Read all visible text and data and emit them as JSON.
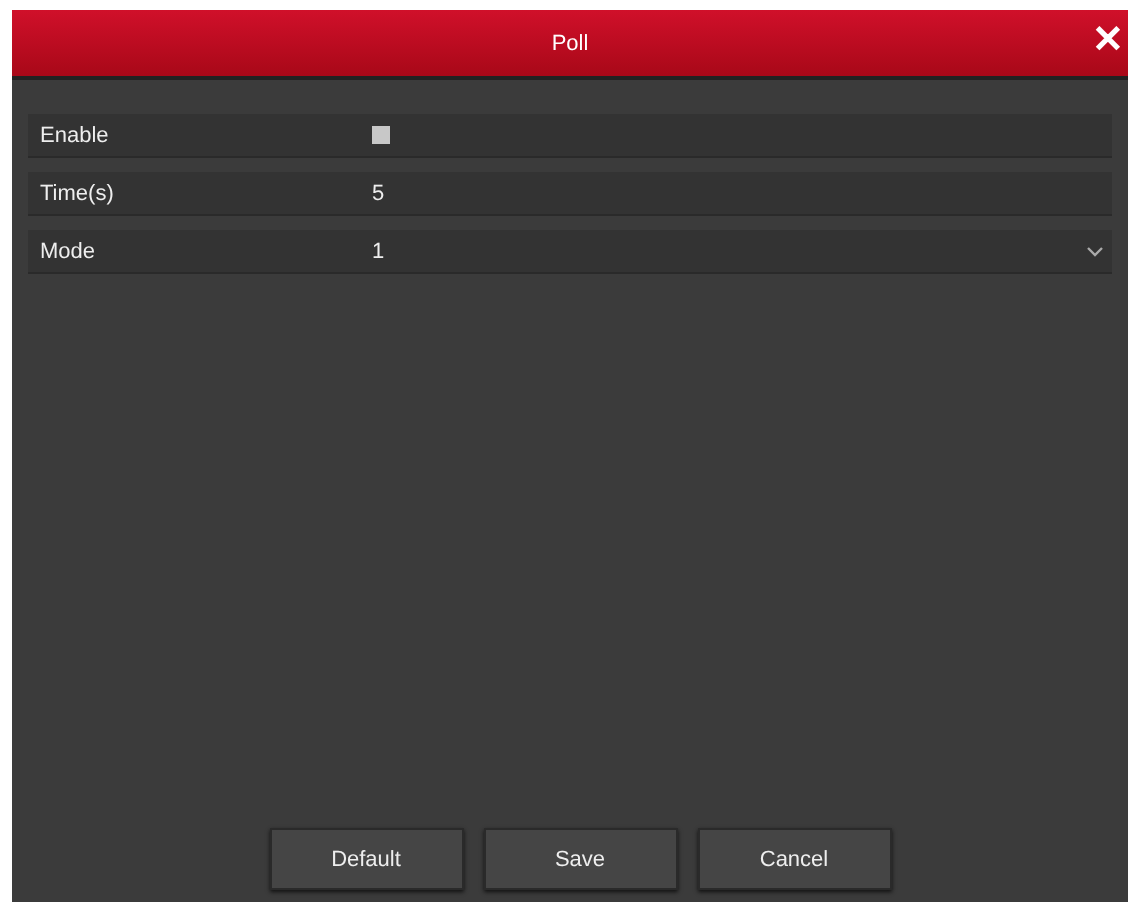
{
  "window": {
    "title": "Poll",
    "close": "✕"
  },
  "fields": [
    {
      "kind": "checkbox",
      "label": "Enable",
      "checked": false
    },
    {
      "kind": "text",
      "label": "Time(s)",
      "value": "5"
    },
    {
      "kind": "select",
      "label": "Mode",
      "value": "1"
    }
  ],
  "buttons": [
    "Default",
    "Save",
    "Cancel"
  ]
}
